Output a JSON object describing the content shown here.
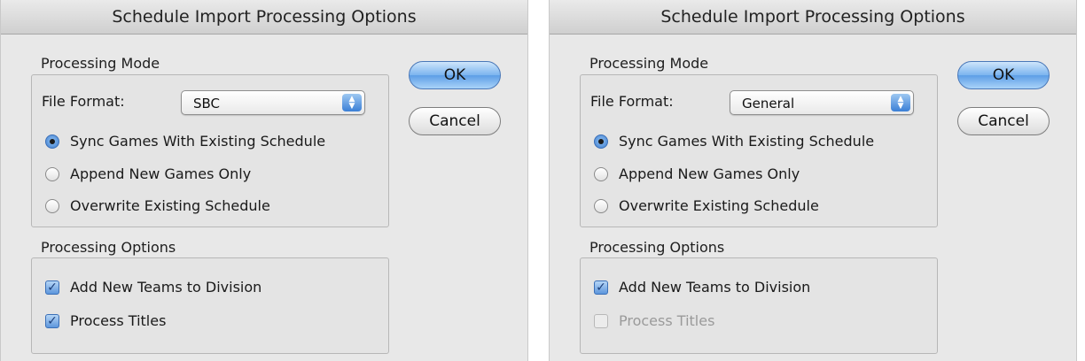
{
  "dialogs": [
    {
      "title": "Schedule Import Processing Options",
      "processing_mode": {
        "heading": "Processing Mode",
        "file_format_label": "File Format:",
        "file_format_value": "SBC",
        "radios": [
          {
            "label": "Sync Games With Existing Schedule",
            "selected": true
          },
          {
            "label": "Append New Games Only",
            "selected": false
          },
          {
            "label": "Overwrite Existing Schedule",
            "selected": false
          }
        ]
      },
      "processing_options": {
        "heading": "Processing Options",
        "checks": [
          {
            "label": "Add New Teams to Division",
            "checked": true,
            "enabled": true
          },
          {
            "label": "Process Titles",
            "checked": true,
            "enabled": true
          }
        ]
      },
      "ok_label": "OK",
      "cancel_label": "Cancel"
    },
    {
      "title": "Schedule Import Processing Options",
      "processing_mode": {
        "heading": "Processing Mode",
        "file_format_label": "File Format:",
        "file_format_value": "General",
        "radios": [
          {
            "label": "Sync Games With Existing Schedule",
            "selected": true
          },
          {
            "label": "Append New Games Only",
            "selected": false
          },
          {
            "label": "Overwrite Existing Schedule",
            "selected": false
          }
        ]
      },
      "processing_options": {
        "heading": "Processing Options",
        "checks": [
          {
            "label": "Add New Teams to Division",
            "checked": true,
            "enabled": true
          },
          {
            "label": "Process Titles",
            "checked": false,
            "enabled": false
          }
        ]
      },
      "ok_label": "OK",
      "cancel_label": "Cancel"
    }
  ],
  "colors": {
    "accent": "#3f7dcf",
    "window_bg": "#e8e8e8",
    "disabled_text": "#9a9a9a"
  }
}
